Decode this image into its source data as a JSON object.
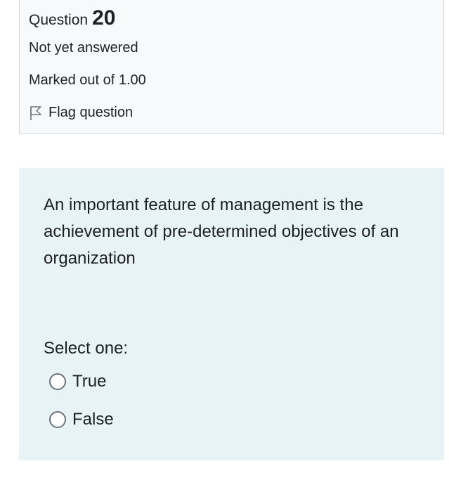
{
  "question_info": {
    "prefix": "Question",
    "number": "20",
    "state": "Not yet answered",
    "grade": "Marked out of 1.00",
    "flag_label": "Flag question"
  },
  "question": {
    "text": "An important feature of management is the achievement of pre-determined objectives of an organization",
    "prompt": "Select one:",
    "answers": [
      {
        "label": "True",
        "selected": false
      },
      {
        "label": "False",
        "selected": false
      }
    ]
  },
  "colors": {
    "info_background": "#f8f9fa",
    "info_border": "#cfd4d9",
    "content_background": "#e7f3f5",
    "text": "#1d2125"
  },
  "icons": {
    "flag": "flag-outline-icon",
    "radio": "radio-button-icon"
  }
}
